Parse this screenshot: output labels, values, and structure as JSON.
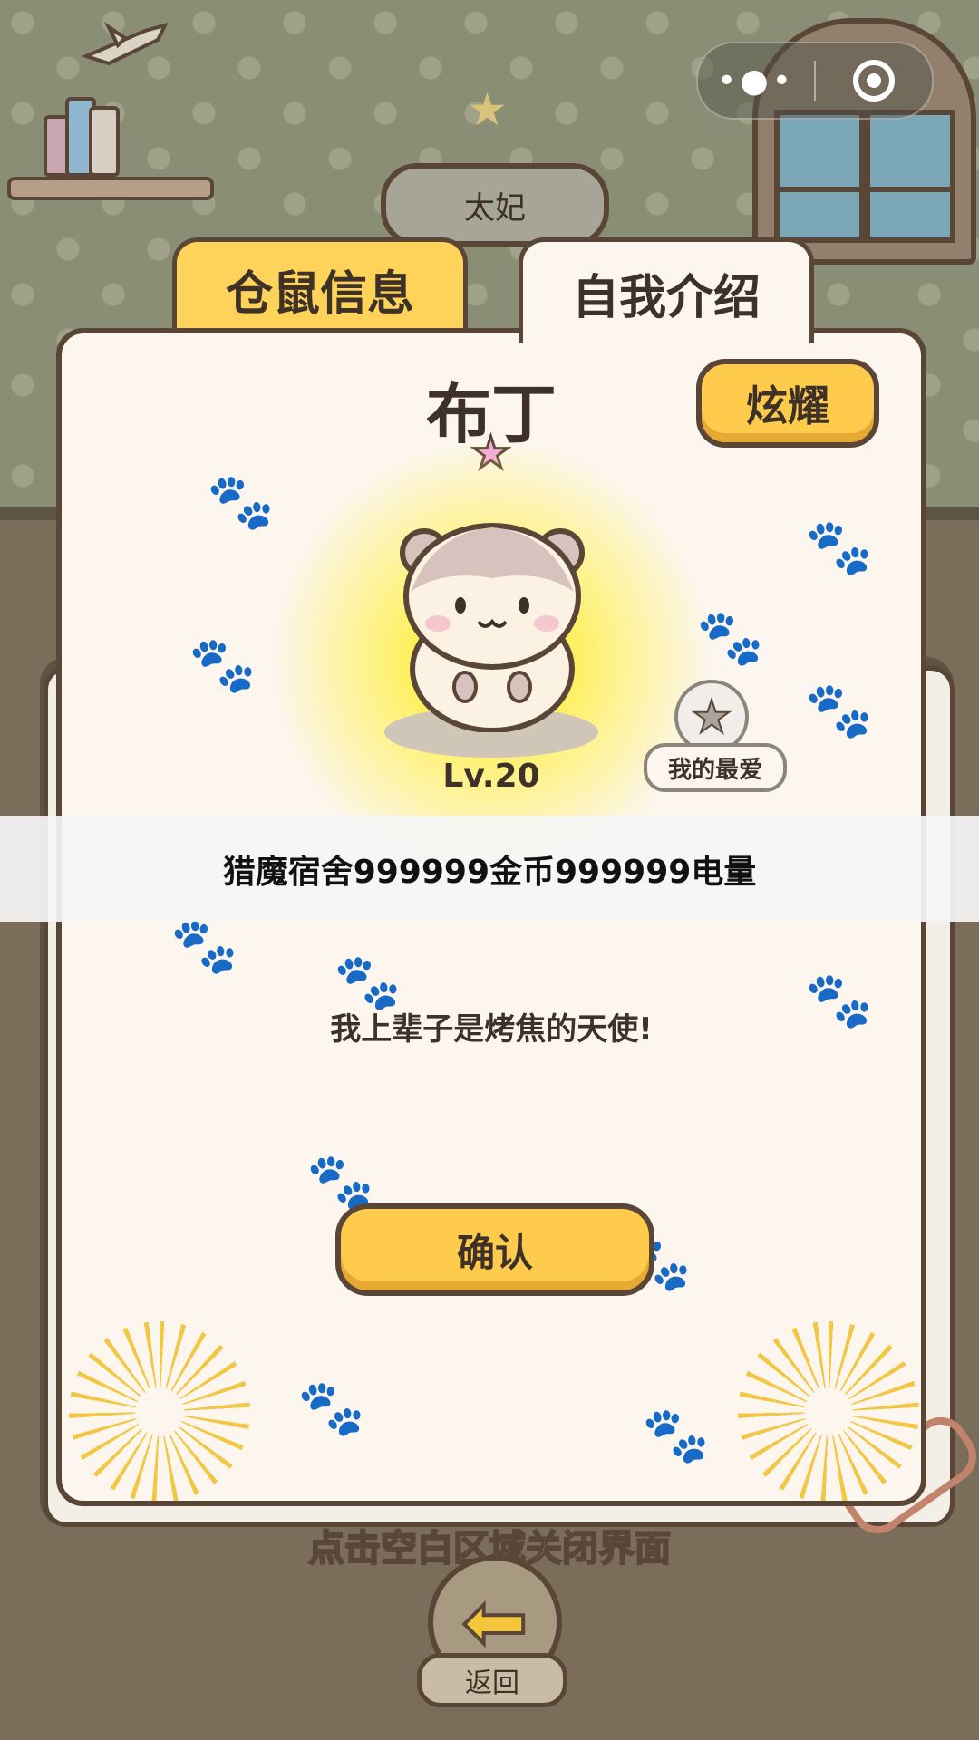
{
  "capsule": {
    "more_icon": "more-dots-icon",
    "close_icon": "target-close-icon"
  },
  "room": {
    "sign_text": "太妃"
  },
  "tabs": [
    {
      "label": "仓鼠信息"
    },
    {
      "label": "自我介绍"
    }
  ],
  "pet": {
    "name": "布丁",
    "level": "Lv.20",
    "favorite_label": "我的最爱",
    "intro": "我上辈子是烤焦的天使!"
  },
  "buttons": {
    "show_off": "炫耀",
    "confirm": "确认"
  },
  "overlay_banner": "猎魔宿舍999999金币999999电量",
  "hint": "点击空白区域关闭界面",
  "back": {
    "label": "返回",
    "icon": "arrow-left-icon"
  },
  "colors": {
    "accent_yellow": "#ffcb4c",
    "outline_brown": "#5a4636",
    "panel_bg": "#fcf6ee"
  }
}
